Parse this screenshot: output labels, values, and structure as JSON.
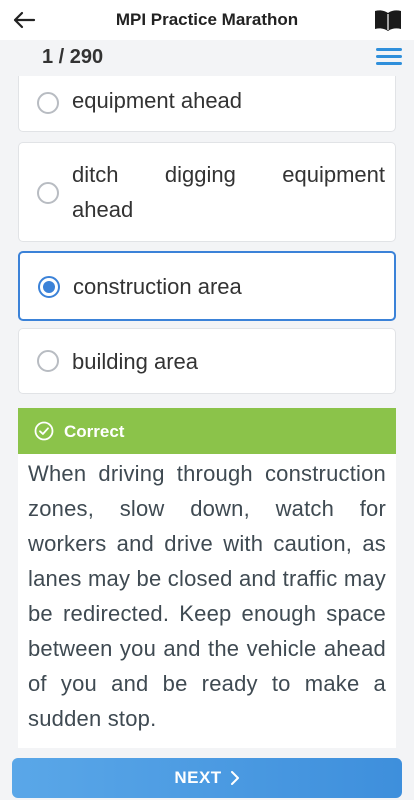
{
  "header": {
    "title": "MPI Practice Marathon",
    "back_icon": "back-arrow-icon",
    "book_icon": "book-icon"
  },
  "progress": {
    "text": "1 / 290",
    "menu_icon": "hamburger-menu-icon",
    "accent": "#2f8fdb"
  },
  "options": [
    {
      "label": "equipment ahead",
      "selected": false
    },
    {
      "label": "ditch digging equipment ahead",
      "selected": false
    },
    {
      "label": "construction area",
      "selected": true
    },
    {
      "label": "building area",
      "selected": false
    }
  ],
  "feedback": {
    "status": "Correct",
    "status_color": "#8bc34a",
    "icon": "check-circle-icon",
    "explanation": "When driving through construction zones, slow down, watch for workers and drive with caution, as lanes may be closed and traffic may be redirected. Keep enough space between you and the vehicle ahead of you and be ready to make a sudden stop."
  },
  "footer": {
    "next_label": "NEXT",
    "next_icon": "chevron-right-icon",
    "button_color": "#3e8fdc"
  }
}
